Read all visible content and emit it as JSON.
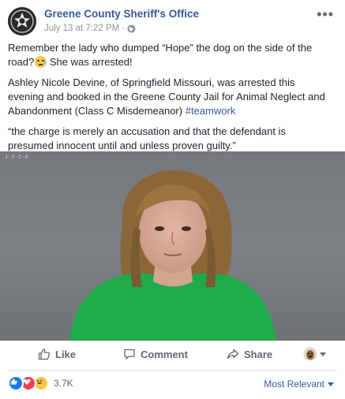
{
  "header": {
    "page_name": "Greene County Sheriff's Office",
    "timestamp": "July 13 at 7:22 PM",
    "separator": "·",
    "audience_icon": "globe-icon",
    "more_label": "•••"
  },
  "post": {
    "paragraph1_before": "Remember the lady who dumped “Hope” the dog on the side of the road?",
    "paragraph1_after": " She was arrested!",
    "paragraph2_text": "Ashley Nicole Devine, of Springfield Missouri, was arrested this evening and booked in the Greene County Jail for Animal Neglect and Abandonment (Class C Misdemeanor) ",
    "hashtag": "#teamwork",
    "paragraph3": "“the charge is merely an accusation and that the defendant is presumed innocent until and unless proven guilty.”"
  },
  "photo": {
    "watermark": "1-2-2-4"
  },
  "actions": {
    "like": "Like",
    "comment": "Comment",
    "share": "Share"
  },
  "reactions": {
    "count": "3.7K",
    "sort_label": "Most Relevant"
  },
  "colors": {
    "link": "#365899",
    "muted": "#606770",
    "like": "#1877f2",
    "love": "#f33e58",
    "haha": "#f7c948",
    "shirt": "#1faa4b"
  }
}
